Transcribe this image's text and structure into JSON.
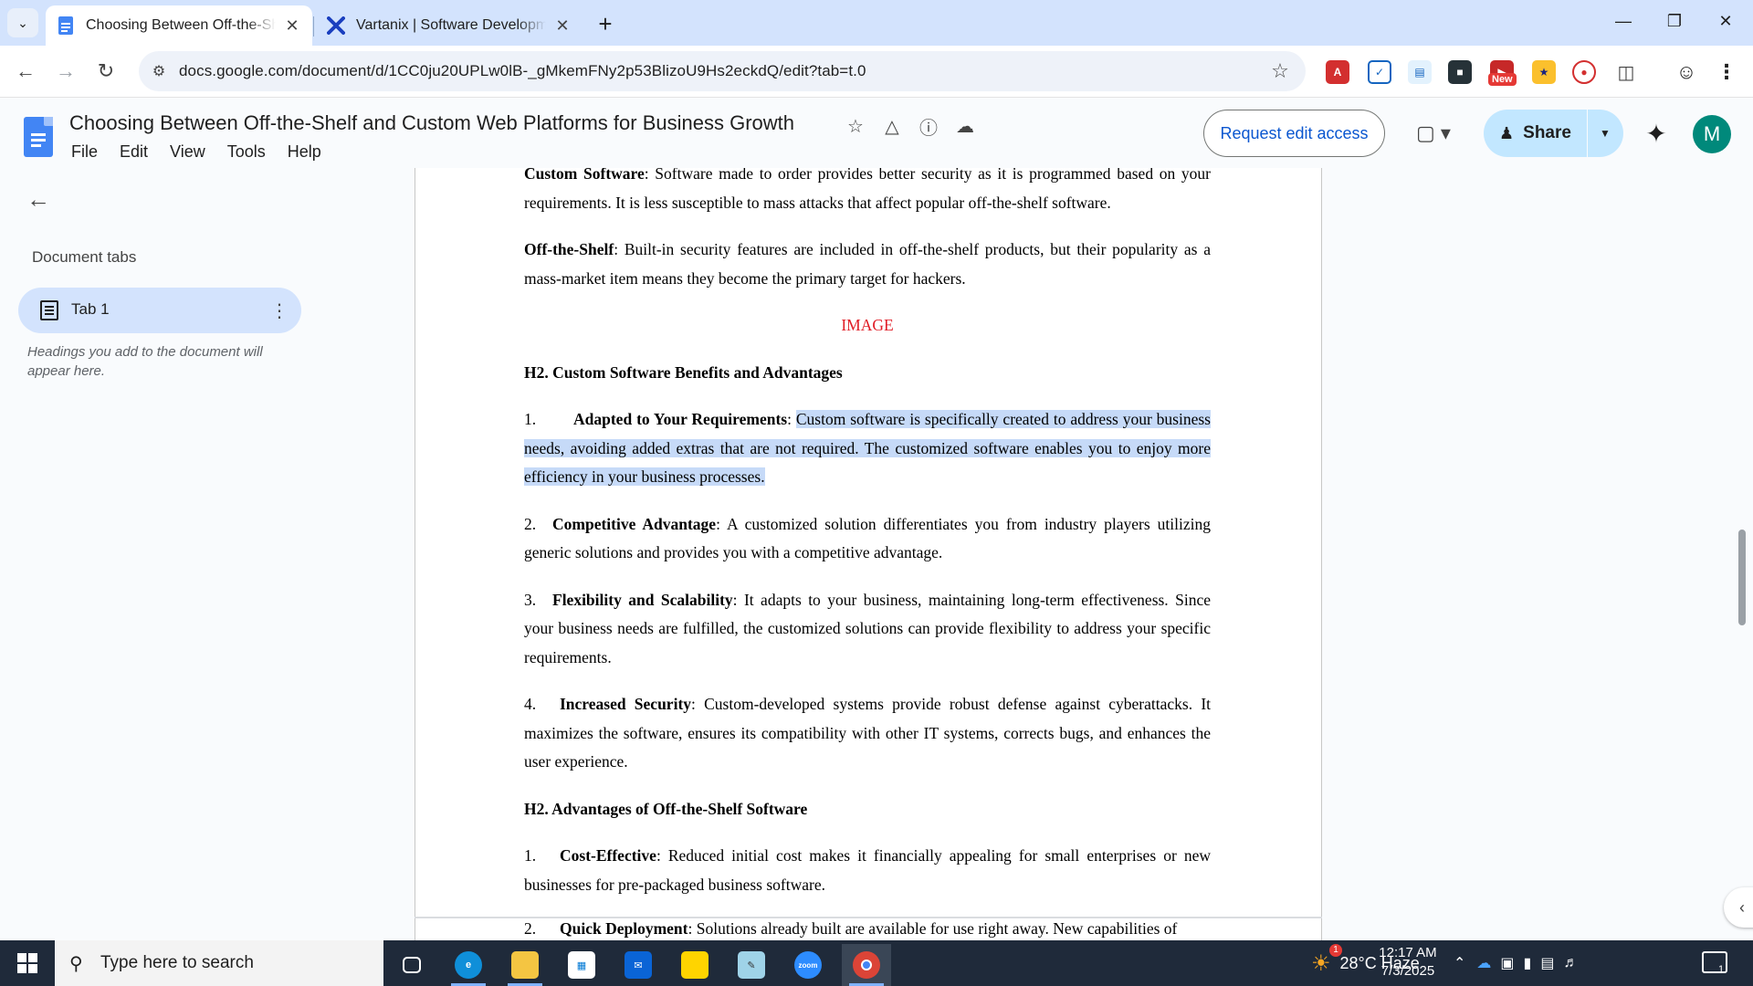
{
  "browser": {
    "tabs": [
      {
        "title": "Choosing Between Off-the-Shelf and Custom Web Platforms",
        "active": true,
        "favicon": "google-docs-icon"
      },
      {
        "title": "Vartanix | Software Development",
        "active": false,
        "favicon": "vartanix-x-icon"
      }
    ],
    "url": "docs.google.com/document/d/1CC0ju20UPLw0lB-_gMkemFNy2p53BlizoU9Hs2eckdQ/edit?tab=t.0",
    "extension_badge": "New"
  },
  "docs": {
    "title": "Choosing Between Off-the-Shelf and Custom Web Platforms for Business Growth",
    "menu": [
      "File",
      "Edit",
      "View",
      "Tools",
      "Help"
    ],
    "request_edit": "Request edit access",
    "share": "Share",
    "avatar_initial": "M"
  },
  "sidebar": {
    "title": "Document tabs",
    "tab_label": "Tab 1",
    "hint": "Headings you add to the document will appear here."
  },
  "document": {
    "p_custom_security": {
      "bold": "Custom Software",
      "text": ": Software made to order provides better security as it is programmed based on your requirements. It is less susceptible to mass attacks that affect popular off-the-shelf software."
    },
    "p_offshelf_security": {
      "bold": "Off-the-Shelf",
      "text": ": Built-in security features are included in off-the-shelf products, but their popularity as a mass-market item means they become the primary target for hackers."
    },
    "image_placeholder": "IMAGE",
    "h2_custom": "H2. Custom Software Benefits and Advantages",
    "custom_items": [
      {
        "num": "1.",
        "bold": "Adapted to Your Requirements",
        "colon": ": ",
        "text": "Custom software is specifically created to address your business needs, avoiding added extras that are not required. The customized software enables you to enjoy more efficiency in your business processes."
      },
      {
        "num": "2.",
        "bold": "Competitive Advantage",
        "text": ": A customized solution differentiates you from industry players utilizing generic solutions and provides you with a competitive advantage."
      },
      {
        "num": "3.",
        "bold": "Flexibility and Scalability",
        "text": ": It adapts to your business, maintaining long-term effectiveness. Since your business needs are fulfilled, the customized solutions can provide flexibility to address your specific requirements."
      },
      {
        "num": "4.",
        "bold": "Increased Security",
        "text": ": Custom-developed systems provide robust defense against cyberattacks.  It maximizes the software, ensures its compatibility with other IT systems, corrects bugs, and enhances the user experience."
      }
    ],
    "h2_offshelf": "H2. Advantages of Off-the-Shelf Software",
    "offshelf_items": [
      {
        "num": "1.",
        "bold": "Cost-Effective",
        "text": ": Reduced initial cost makes it financially appealing for small enterprises or new businesses for pre-packaged business software."
      },
      {
        "num": "2.",
        "bold": "Quick Deployment",
        "text": ": Solutions already built are available for use right away. New capabilities of"
      }
    ]
  },
  "taskbar": {
    "search_placeholder": "Type here to search",
    "weather": "28°C  Haze",
    "weather_badge": "1",
    "time": "12:17 AM",
    "date": "7/3/2025",
    "notification_count": "1"
  },
  "colors": {
    "tabstrip": "#d3e3fd",
    "selection": "#c6daf8",
    "share_button": "#c2e7ff",
    "image_placeholder": "#e01b24",
    "taskbar": "#1f2a3a"
  }
}
